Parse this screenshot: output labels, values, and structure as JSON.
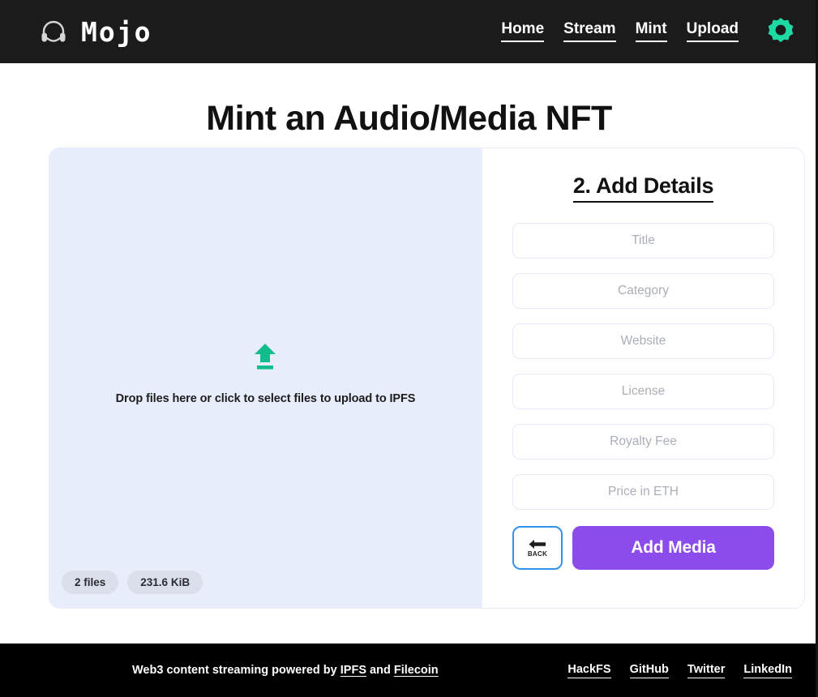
{
  "header": {
    "brand_name": "Mojo",
    "logo_icon": "headphones-icon",
    "nav": [
      {
        "label": "Home"
      },
      {
        "label": "Stream"
      },
      {
        "label": "Mint"
      },
      {
        "label": "Upload"
      }
    ],
    "theme_toggle_icon": "brightness-sun-icon",
    "theme_toggle_color": "#1ed9a4"
  },
  "main": {
    "page_title": "Mint an Audio/Media NFT",
    "dropzone": {
      "icon": "upload-arrow-icon",
      "icon_color": "#12bd8b",
      "text": "Drop files here or click to select files to upload to IPFS",
      "background": "#e8edfb",
      "badges": [
        {
          "label": "2 files"
        },
        {
          "label": "231.6 KiB"
        }
      ]
    },
    "details": {
      "title": "2. Add Details",
      "fields": [
        {
          "name": "title",
          "placeholder": "Title",
          "value": ""
        },
        {
          "name": "category",
          "placeholder": "Category",
          "value": ""
        },
        {
          "name": "website",
          "placeholder": "Website",
          "value": ""
        },
        {
          "name": "license",
          "placeholder": "License",
          "value": ""
        },
        {
          "name": "royalty_fee",
          "placeholder": "Royalty Fee",
          "value": ""
        },
        {
          "name": "price_eth",
          "placeholder": "Price in ETH",
          "value": ""
        }
      ],
      "back_button": {
        "label": "BACK",
        "icon": "arrow-left-icon",
        "border_color": "#2f93ec"
      },
      "primary_button": {
        "label": "Add Media",
        "color": "#8b4ceb"
      }
    }
  },
  "footer": {
    "text_prefix": "Web3 content streaming powered by ",
    "link_ipfs": "IPFS",
    "text_middle": " and ",
    "link_filecoin": "Filecoin",
    "links": [
      {
        "label": "HackFS"
      },
      {
        "label": "GitHub"
      },
      {
        "label": "Twitter"
      },
      {
        "label": "LinkedIn"
      }
    ]
  }
}
